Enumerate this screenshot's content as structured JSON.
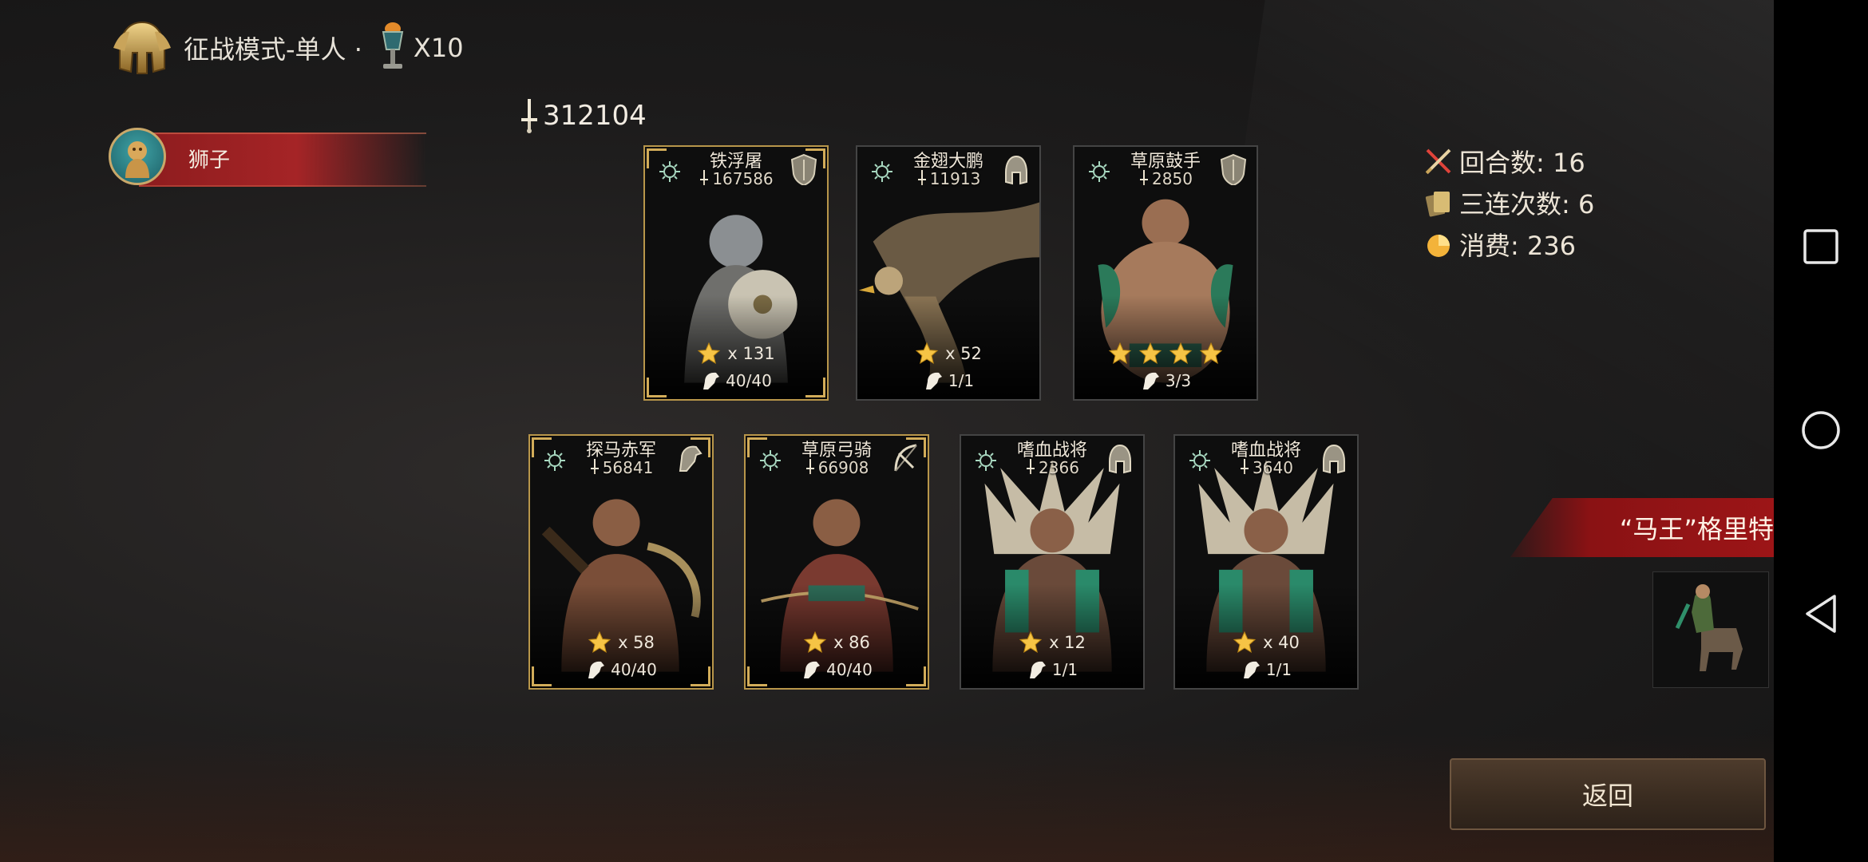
{
  "header": {
    "mode_title": "征战模式-单人 ·",
    "ticket_count": "X10"
  },
  "player": {
    "name": "狮子"
  },
  "total_power": "312104",
  "cards_top": [
    {
      "name": "铁浮屠",
      "power": "167586",
      "star_display": "multiplier",
      "star_count": "x 131",
      "troops": "40/40",
      "frame": "gold",
      "class_icon": "shield-icon"
    },
    {
      "name": "金翅大鹏",
      "power": "11913",
      "star_display": "multiplier",
      "star_count": "x 52",
      "troops": "1/1",
      "frame": "plain",
      "class_icon": "helmet-class-icon"
    },
    {
      "name": "草原鼓手",
      "power": "2850",
      "star_display": "stars",
      "stars": 4,
      "troops": "3/3",
      "frame": "plain",
      "class_icon": "shield-icon"
    }
  ],
  "cards_bottom": [
    {
      "name": "探马赤军",
      "power": "56841",
      "star_display": "multiplier",
      "star_count": "x 58",
      "troops": "40/40",
      "frame": "gold",
      "class_icon": "horse-class-icon"
    },
    {
      "name": "草原弓骑",
      "power": "66908",
      "star_display": "multiplier",
      "star_count": "x 86",
      "troops": "40/40",
      "frame": "gold",
      "class_icon": "bow-class-icon"
    },
    {
      "name": "嗜血战将",
      "power": "2366",
      "star_display": "multiplier",
      "star_count": "x 12",
      "troops": "1/1",
      "frame": "plain",
      "class_icon": "helmet-class-icon"
    },
    {
      "name": "嗜血战将",
      "power": "3640",
      "star_display": "multiplier",
      "star_count": "x 40",
      "troops": "1/1",
      "frame": "plain",
      "class_icon": "helmet-class-icon"
    }
  ],
  "stats": {
    "rounds": "回合数: 16",
    "triples": "三连次数: 6",
    "cost": "消费: 236"
  },
  "boss": {
    "name": "“马王”格里特"
  },
  "buttons": {
    "return_label": "返回"
  },
  "colors": {
    "gold_frame": "#b8964a",
    "banner_red": "#9c1517",
    "star_gold": "#f6c445"
  }
}
